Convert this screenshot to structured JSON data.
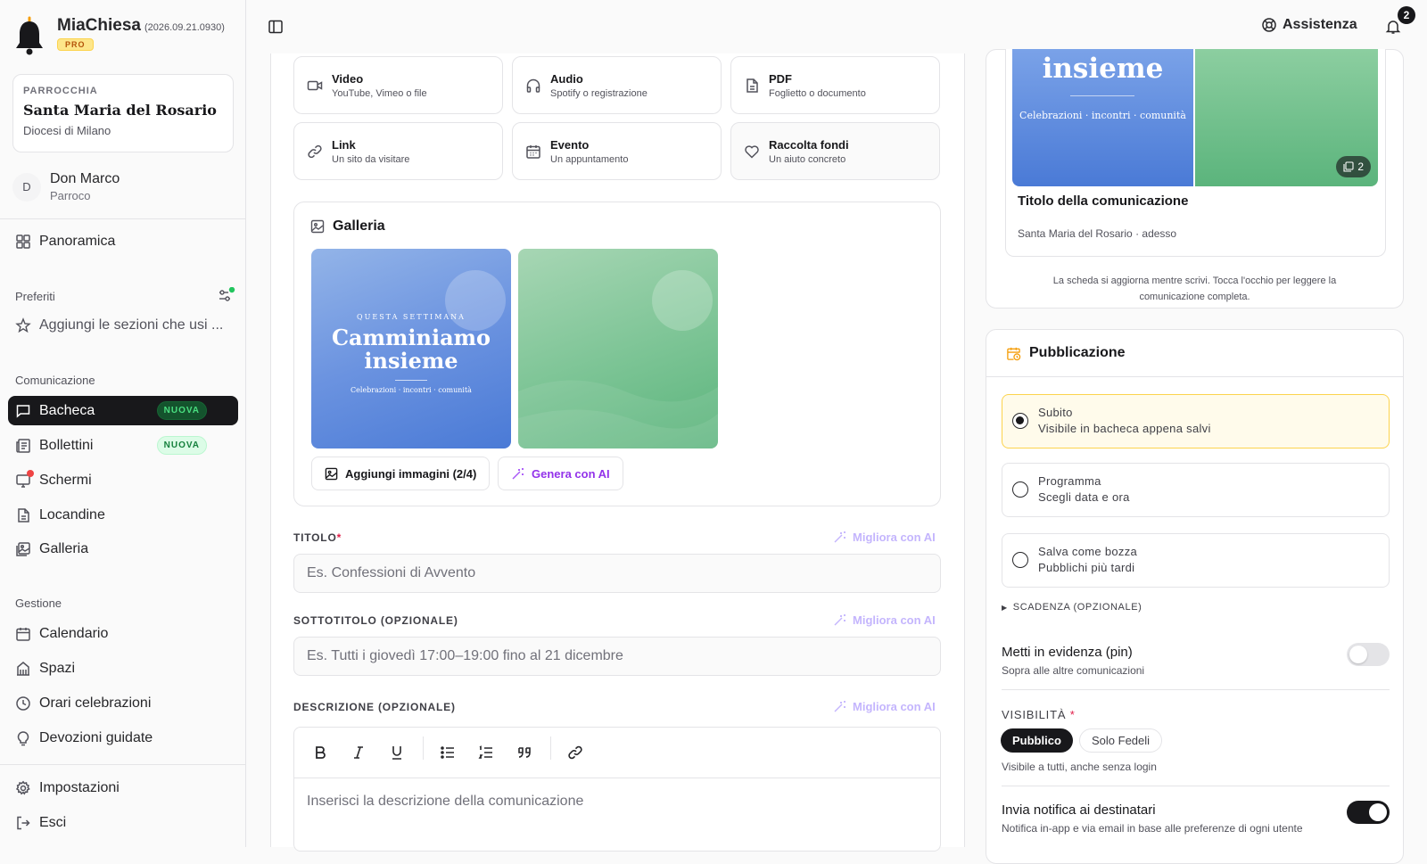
{
  "app": {
    "name": "MiaChiesa",
    "version": "(2026.09.21.0930)",
    "plan": "PRO"
  },
  "parish": {
    "label": "PARROCCHIA",
    "name": "Santa Maria del Rosario",
    "diocese": "Diocesi di Milano"
  },
  "user": {
    "initial": "D",
    "name": "Don Marco",
    "role": "Parroco"
  },
  "nav": {
    "overview": "Panoramica",
    "favorites_title": "Preferiti",
    "favorites_add": "Aggiungi le sezioni che usi ...",
    "communication_title": "Comunicazione",
    "communication_items": [
      {
        "label": "Bacheca",
        "badge": "NUOVA"
      },
      {
        "label": "Bollettini",
        "badge": "NUOVA"
      },
      {
        "label": "Schermi"
      },
      {
        "label": "Locandine"
      },
      {
        "label": "Galleria"
      }
    ],
    "management_title": "Gestione",
    "management_items": [
      {
        "label": "Calendario"
      },
      {
        "label": "Spazi"
      },
      {
        "label": "Orari celebrazioni"
      },
      {
        "label": "Devozioni guidate"
      }
    ],
    "settings": "Impostazioni",
    "logout": "Esci"
  },
  "topbar": {
    "help": "Assistenza",
    "notifications_count": "2"
  },
  "content_types": [
    {
      "title": "Video",
      "subtitle": "YouTube, Vimeo o file",
      "icon": "video-icon"
    },
    {
      "title": "Audio",
      "subtitle": "Spotify o registrazione",
      "icon": "headphones-icon"
    },
    {
      "title": "PDF",
      "subtitle": "Foglietto o documento",
      "icon": "file-icon"
    },
    {
      "title": "Link",
      "subtitle": "Un sito da visitare",
      "icon": "link-icon"
    },
    {
      "title": "Evento",
      "subtitle": "Un appuntamento",
      "icon": "calendar-icon"
    },
    {
      "title": "Raccolta fondi",
      "subtitle": "Un aiuto concreto",
      "icon": "heart-icon"
    }
  ],
  "gallery": {
    "title": "Galleria",
    "image1": {
      "kicker": "QUESTA SETTIMANA",
      "title_line1": "Camminiamo",
      "title_line2": "insieme",
      "caption": "Celebrazioni · incontri · comunità"
    },
    "add_images": "Aggiungi immagini (2/4)",
    "generate_ai": "Genera con AI"
  },
  "form": {
    "title_label": "TITOLO",
    "title_placeholder": "Es. Confessioni di Avvento",
    "subtitle_label": "SOTTOTITOLO (OPZIONALE)",
    "subtitle_placeholder": "Es. Tutti i giovedì 17:00–19:00 fino al 21 dicembre",
    "description_label": "DESCRIZIONE (OPZIONALE)",
    "description_placeholder": "Inserisci la descrizione della comunicazione",
    "improve_ai": "Migliora con AI",
    "required_mark": "*"
  },
  "preview": {
    "img_title": "insieme",
    "img_caption": "Celebrazioni · incontri · comunità",
    "count": "2",
    "title": "Titolo della comunicazione",
    "meta": "Santa Maria del Rosario · adesso",
    "hint": "La scheda si aggiorna mentre scrivi. Tocca l'occhio per leggere la comunicazione completa."
  },
  "publication": {
    "title": "Pubblicazione",
    "options": [
      {
        "title": "Subito",
        "subtitle": "Visibile in bacheca appena salvi",
        "selected": true
      },
      {
        "title": "Programma",
        "subtitle": "Scegli data e ora",
        "selected": false
      },
      {
        "title": "Salva come bozza",
        "subtitle": "Pubblichi più tardi",
        "selected": false
      }
    ],
    "deadline": "SCADENZA (OPZIONALE)",
    "pin_title": "Metti in evidenza (pin)",
    "pin_subtitle": "Sopra alle altre comunicazioni",
    "pin_on": false,
    "visibility_label": "VISIBILITÀ",
    "visibility_options": [
      "Pubblico",
      "Solo Fedeli"
    ],
    "visibility_selected": "Pubblico",
    "visibility_hint": "Visibile a tutti, anche senza login",
    "notify_title": "Invia notifica ai destinatari",
    "notify_subtitle": "Notifica in-app e via email in base alle preferenze di ogni utente",
    "notify_on": true
  },
  "colors": {
    "accent_dark": "#18181b",
    "success": "#22c55e",
    "ai_purple": "#a78bfa",
    "selected_bg": "#fffbeb",
    "required": "#e11d48"
  }
}
